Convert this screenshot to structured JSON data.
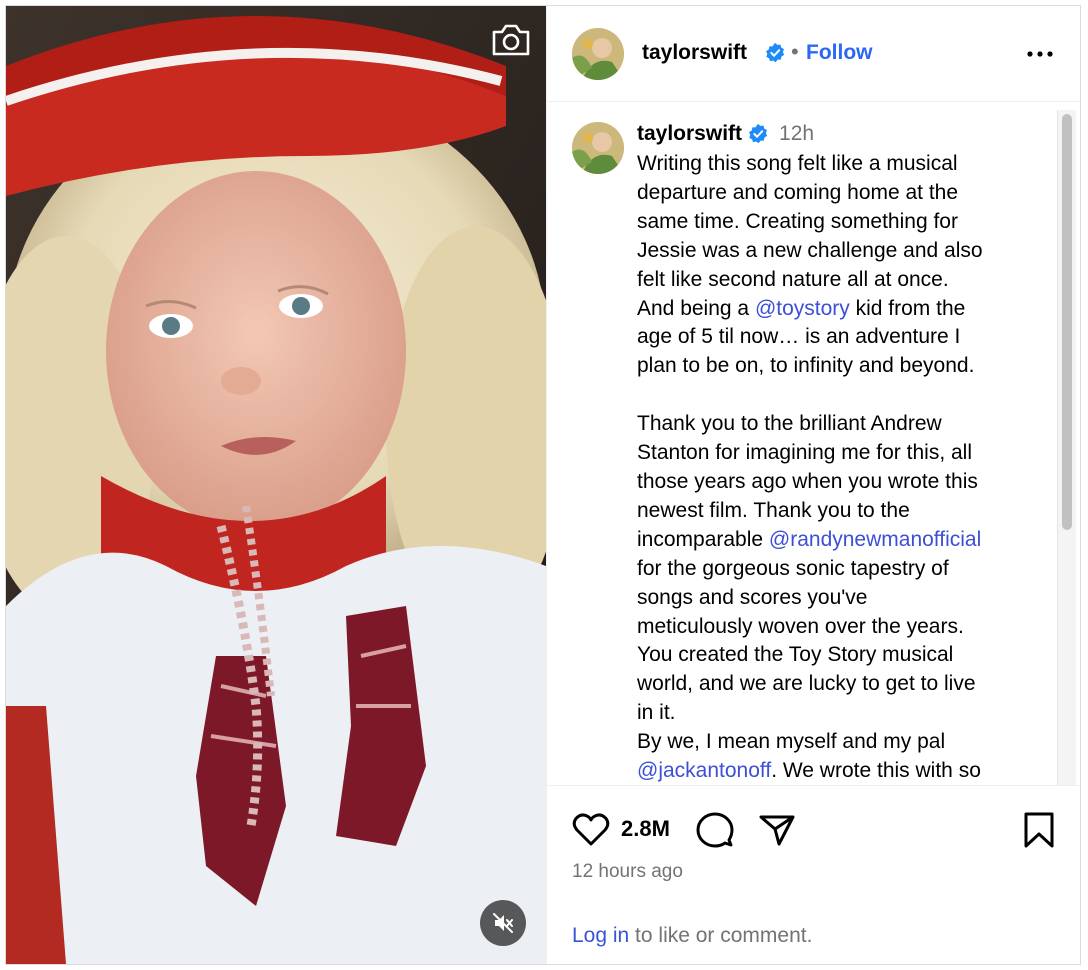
{
  "colors": {
    "accent_blue": "#2b67f6",
    "link_blue": "#3a54d6",
    "muted_text": "#737373",
    "verified_blue": "#1d8cf8"
  },
  "header": {
    "username": "taylorswift",
    "separator": "•",
    "follow_label": "Follow",
    "more_icon": "more-horizontal-icon",
    "verified_icon": "verified-badge-icon"
  },
  "media": {
    "camera_icon": "camera-icon",
    "mute_icon": "speaker-muted-icon"
  },
  "caption": {
    "username": "taylorswift",
    "time_ago": "12h",
    "segments": [
      {
        "text": "Writing this song felt like a musical\ndeparture and coming home at the\nsame time. Creating something for\nJessie was a new challenge and also\nfelt like second nature all at once.\nAnd being a ",
        "mention": false
      },
      {
        "text": "@toystory",
        "mention": true
      },
      {
        "text": " kid from the\nage of 5 til now… is an adventure I\nplan to be on, to infinity and beyond.\n\nThank you to the brilliant Andrew\nStanton for imagining me for this, all\nthose years ago when you wrote this\nnewest film. Thank you to the\nincomparable ",
        "mention": false
      },
      {
        "text": "@randynewmanofficial",
        "mention": true
      },
      {
        "text": "\nfor the gorgeous sonic tapestry of\nsongs and scores you've\nmeticulously woven over the years.\nYou created the Toy Story musical\nworld, and we are lucky to get to live\nin it.\nBy we, I mean myself and my pal\n",
        "mention": false
      },
      {
        "text": "@jackantonoff",
        "mention": true
      },
      {
        "text": ". We wrote this with so",
        "mention": false
      }
    ]
  },
  "actions": {
    "like_icon": "heart-icon",
    "likes_count": "2.8M",
    "comment_icon": "comment-bubble-icon",
    "share_icon": "paper-plane-icon",
    "save_icon": "bookmark-icon",
    "post_time": "12 hours ago",
    "login_link": "Log in",
    "login_suffix": " to like or comment."
  }
}
